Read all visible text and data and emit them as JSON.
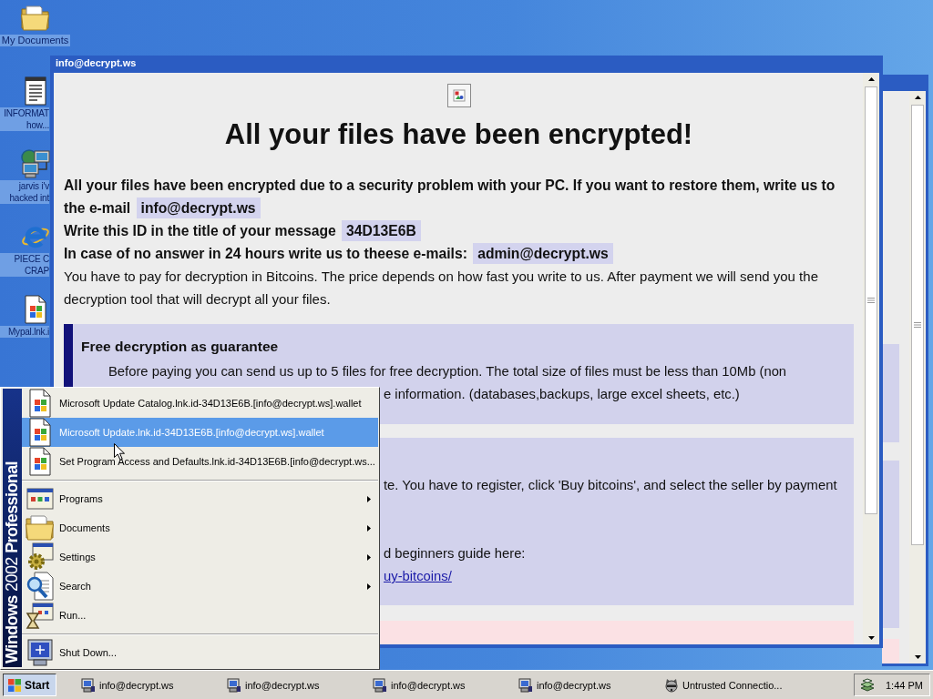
{
  "desktop_icons": [
    {
      "kind": "folder",
      "label": "My Documents",
      "partly_hidden": false
    },
    {
      "kind": "notepad",
      "label": "INFORMAT\nhow...",
      "partly_hidden": true
    },
    {
      "kind": "network",
      "label": "jarvis i'v\nhacked int",
      "partly_hidden": true
    },
    {
      "kind": "browser",
      "label": "PIECE C\nCRAP",
      "partly_hidden": true
    },
    {
      "kind": "program",
      "label": "Mypal.lnk.i",
      "partly_hidden": true
    }
  ],
  "window": {
    "title": "info@decrypt.ws",
    "heading": "All your files have been encrypted!",
    "message": [
      {
        "kind": "strong",
        "text": "All your files have been encrypted due to a security problem with your PC. If you want to restore them, write us to the e-mail",
        "highlight": "info@decrypt.ws"
      },
      {
        "kind": "strong",
        "text": "Write this ID in the title of your message",
        "highlight": "34D13E6B"
      },
      {
        "kind": "strong",
        "text": "In case of no answer in 24 hours write us to theese e-mails:",
        "highlight": "admin@decrypt.ws"
      },
      {
        "kind": "plain",
        "text": "You have to pay for decryption in Bitcoins. The price depends on how fast you write to us. After payment we will send you the decryption tool that will decrypt all your files."
      }
    ],
    "panels": [
      {
        "kind": "guarantee",
        "title": "Free decryption as guarantee",
        "paragraphs": [
          [
            {
              "kind": "text",
              "text": "Before paying you can send us up to 5 files for free decryption. The total size of files must be less than 10Mb (non",
              "partly_hidden": false
            },
            {
              "kind": "text",
              "text": "e information. (databases,backups, large excel sheets, etc.)",
              "partly_hidden": true
            }
          ]
        ]
      },
      {
        "kind": "howto",
        "paragraphs": [
          [
            {
              "kind": "text",
              "text": "te. You have to register, click 'Buy bitcoins', and select the seller by payment",
              "partly_hidden": true
            }
          ],
          [
            {
              "kind": "text",
              "text": "d beginners guide here:",
              "partly_hidden": true
            },
            {
              "kind": "link",
              "text": "uy-bitcoins/",
              "partly_hidden": true
            }
          ]
        ]
      },
      {
        "kind": "notice"
      }
    ]
  },
  "start_menu": {
    "banner": "**Windows** 2002 **Professional**",
    "items": [
      {
        "kind": "document",
        "label": "Microsoft Update Catalog.lnk.id-34D13E6B.[info@decrypt.ws].wallet",
        "selected": false,
        "submenu": false
      },
      {
        "kind": "document",
        "label": "Microsoft Update.lnk.id-34D13E6B.[info@decrypt.ws].wallet",
        "selected": true,
        "submenu": false
      },
      {
        "kind": "document",
        "label": "Set Program Access and Defaults.lnk.id-34D13E6B.[info@decrypt.ws...",
        "selected": false,
        "submenu": false
      },
      {
        "kind": "separator"
      },
      {
        "kind": "programs",
        "label": "Programs",
        "selected": false,
        "submenu": true
      },
      {
        "kind": "folder",
        "label": "Documents",
        "selected": false,
        "submenu": true
      },
      {
        "kind": "settings",
        "label": "Settings",
        "selected": false,
        "submenu": true
      },
      {
        "kind": "search",
        "label": "Search",
        "selected": false,
        "submenu": true
      },
      {
        "kind": "run",
        "label": "Run...",
        "selected": false,
        "submenu": false
      },
      {
        "kind": "separator"
      },
      {
        "kind": "shutdown",
        "label": "Shut Down...",
        "selected": false,
        "submenu": false
      }
    ]
  },
  "taskbar": {
    "start_button": {
      "label": "Start",
      "pressed": true
    },
    "tasks": [
      {
        "kind": "computer",
        "label": "info@decrypt.ws",
        "selected": false
      },
      {
        "kind": "computer",
        "label": "info@decrypt.ws",
        "selected": false
      },
      {
        "kind": "computer",
        "label": "info@decrypt.ws",
        "selected": false
      },
      {
        "kind": "computer",
        "label": "info@decrypt.ws",
        "selected": false
      },
      {
        "kind": "animal",
        "label": "Untrusted Connectio...",
        "selected": false
      }
    ],
    "clock": "1:44 PM"
  }
}
